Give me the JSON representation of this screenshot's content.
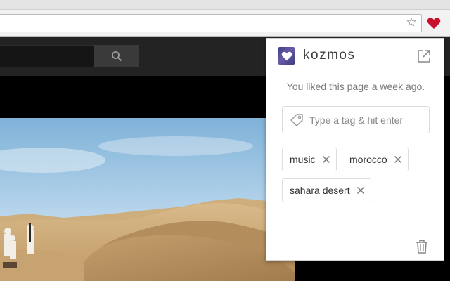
{
  "extension": {
    "icon": "heart-icon",
    "color": "#c8102e"
  },
  "browser": {
    "bookmark_icon": "star-outline-icon",
    "bookmark_glyph": "☆"
  },
  "site": {
    "search_icon": "magnifier-icon"
  },
  "popup": {
    "title": "kozmos",
    "logo_icon": "kozmos-heart-logo-icon",
    "open_icon": "external-link-icon",
    "message": "You liked this page a week ago.",
    "tag_input_placeholder": "Type a tag & hit enter",
    "tag_icon": "tag-icon",
    "tags": [
      {
        "label": "music"
      },
      {
        "label": "morocco"
      },
      {
        "label": "sahara desert"
      }
    ],
    "remove_icon": "close-icon",
    "delete_icon": "trash-icon"
  }
}
